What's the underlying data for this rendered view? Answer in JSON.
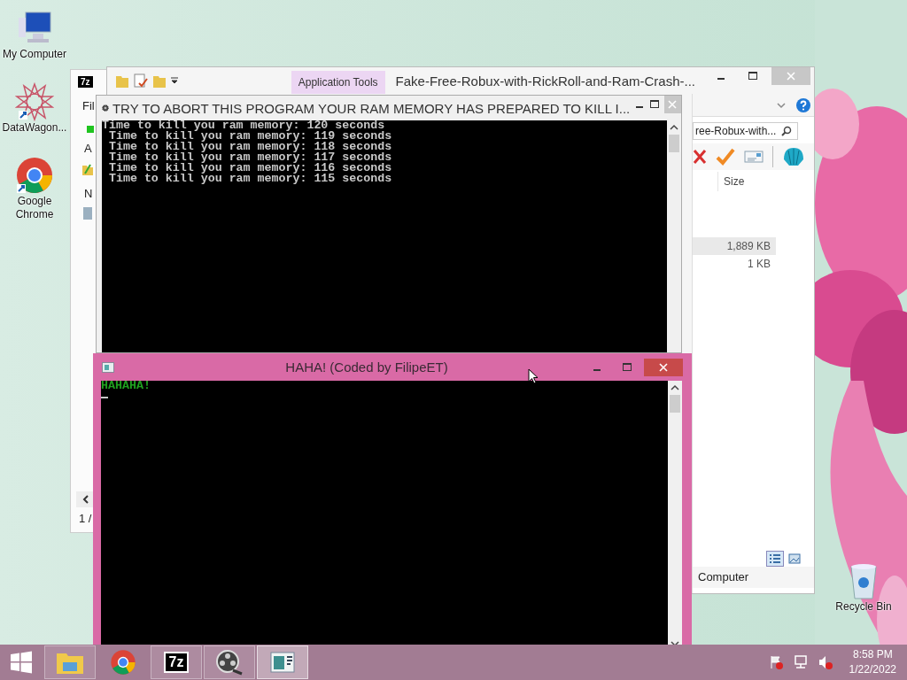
{
  "desktop_icons": [
    {
      "label": "My Computer",
      "kind": "computer"
    },
    {
      "label": "DataWagon...",
      "kind": "star"
    },
    {
      "label": "Google Chrome",
      "kind": "chrome"
    }
  ],
  "recycle_bin": {
    "label": "Recycle Bin"
  },
  "archive_window": {
    "icon_text": "7z",
    "menu_text": "Fil",
    "toolbar_text": "A",
    "column_text": "N",
    "status_text": "1 /"
  },
  "explorer": {
    "ribbon_tab": "Application Tools",
    "title": "Fake-Free-Robux-with-RickRoll-and-Ram-Crash-...",
    "search": "ree-Robux-with...",
    "column": "Size",
    "rows": [
      {
        "size": "1,889 KB",
        "selected": true
      },
      {
        "size": "1 KB",
        "selected": false
      }
    ],
    "status": "Computer"
  },
  "console": {
    "title": "TRY TO ABORT THIS PROGRAM YOUR RAM MEMORY HAS PREPARED TO KILL I...",
    "lines": [
      "Time to kill you ram memory: 120 seconds",
      " Time to kill you ram memory: 119 seconds",
      " Time to kill you ram memory: 118 seconds",
      " Time to kill you ram memory: 117 seconds",
      " Time to kill you ram memory: 116 seconds",
      " Time to kill you ram memory: 115 seconds"
    ]
  },
  "popup": {
    "title": "HAHA! (Coded by FilipeET)",
    "lines": [
      "HAHAHA!"
    ]
  },
  "taskbar": {
    "apps": [
      {
        "kind": "explorer",
        "running": true,
        "selected": false
      },
      {
        "kind": "chrome",
        "running": false,
        "selected": false
      },
      {
        "kind": "archive",
        "label": "7z",
        "running": true,
        "selected": false
      },
      {
        "kind": "film",
        "running": true,
        "selected": false
      },
      {
        "kind": "console",
        "running": true,
        "selected": true
      }
    ],
    "time": "8:58 PM",
    "date": "1/22/2022"
  }
}
